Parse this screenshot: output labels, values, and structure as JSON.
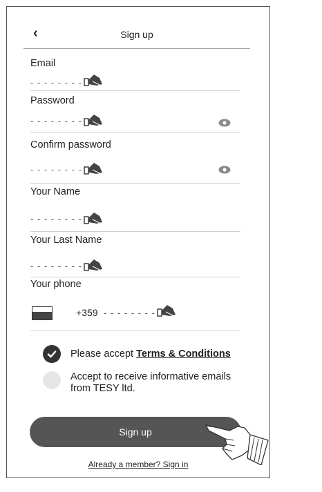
{
  "header": {
    "title": "Sign up",
    "back_icon": "chevron-left-icon"
  },
  "fields": {
    "email": {
      "label": "Email",
      "placeholder": "- - - - - - - -"
    },
    "password": {
      "label": "Password",
      "placeholder": "- - - - - - - -"
    },
    "confirm_password": {
      "label": "Confirm password",
      "placeholder": "- - - - - - - -"
    },
    "first_name": {
      "label": "Your Name",
      "placeholder": "- - - - - - - -"
    },
    "last_name": {
      "label": "Your Last Name",
      "placeholder": "- - - - - - - -"
    },
    "phone": {
      "label": "Your phone",
      "prefix": "+359",
      "placeholder": "- - - - - - - -"
    }
  },
  "consent": {
    "terms_prefix": "Please accept ",
    "terms_link": "Terms & Conditions",
    "terms_checked": true,
    "emails_line1": "Accept to receive informative emails",
    "emails_line2": "from TESY ltd.",
    "emails_checked": false
  },
  "actions": {
    "signup_label": "Sign up",
    "signin_link": "Already a member? Sign in"
  },
  "colors": {
    "button": "#555555",
    "check_on": "#333333",
    "check_off": "#e6e6e6"
  }
}
